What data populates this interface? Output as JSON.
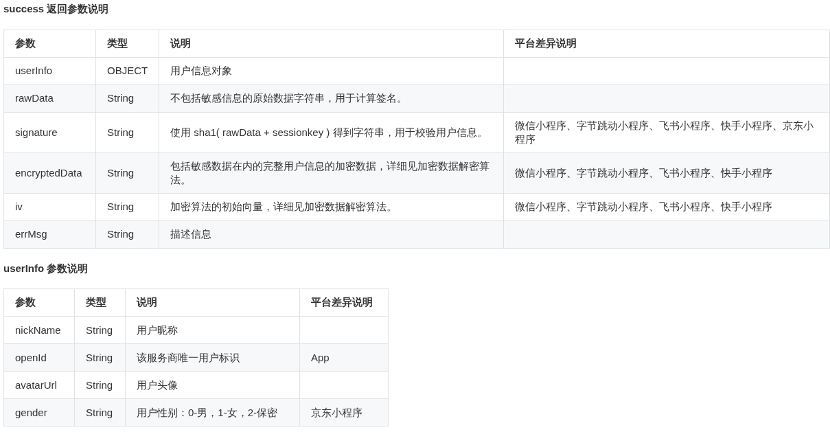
{
  "sections": [
    {
      "heading": "success 返回参数说明",
      "columns": [
        "参数",
        "类型",
        "说明",
        "平台差异说明"
      ],
      "rows": [
        [
          "userInfo",
          "OBJECT",
          "用户信息对象",
          ""
        ],
        [
          "rawData",
          "String",
          "不包括敏感信息的原始数据字符串，用于计算签名。",
          ""
        ],
        [
          "signature",
          "String",
          "使用 sha1( rawData + sessionkey ) 得到字符串，用于校验用户信息。",
          "微信小程序、字节跳动小程序、飞书小程序、快手小程序、京东小程序"
        ],
        [
          "encryptedData",
          "String",
          "包括敏感数据在内的完整用户信息的加密数据，详细见加密数据解密算法。",
          "微信小程序、字节跳动小程序、飞书小程序、快手小程序"
        ],
        [
          "iv",
          "String",
          "加密算法的初始向量，详细见加密数据解密算法。",
          "微信小程序、字节跳动小程序、飞书小程序、快手小程序"
        ],
        [
          "errMsg",
          "String",
          "描述信息",
          ""
        ]
      ]
    },
    {
      "heading": "userInfo 参数说明",
      "columns": [
        "参数",
        "类型",
        "说明",
        "平台差异说明"
      ],
      "rows": [
        [
          "nickName",
          "String",
          "用户昵称",
          ""
        ],
        [
          "openId",
          "String",
          "该服务商唯一用户标识",
          "App"
        ],
        [
          "avatarUrl",
          "String",
          "用户头像",
          ""
        ],
        [
          "gender",
          "String",
          "用户性别：0-男，1-女，2-保密",
          "京东小程序"
        ]
      ]
    }
  ]
}
